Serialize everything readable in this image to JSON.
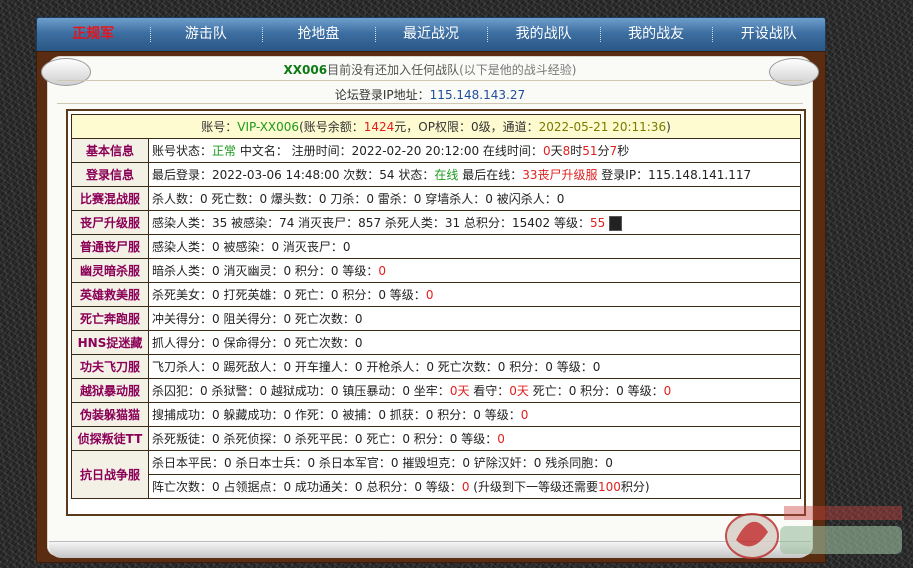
{
  "nav": {
    "items": [
      "正规军",
      "游击队",
      "抢地盘",
      "最近战况",
      "我的战队",
      "我的战友",
      "开设战队"
    ]
  },
  "header": {
    "user": "XX006",
    "status": "目前没有还加入任何战队",
    "note": "(以下是他的战斗经验)",
    "ip_label": "论坛登录IP地址：",
    "ip": "115.148.143.27"
  },
  "account": {
    "prefix": "账号：",
    "id": "VIP-XX006",
    "balance_label": "(账号余额：",
    "balance": "1424",
    "op_label": "元，OP权限：0级，通道：",
    "time": "2022-05-21 20:11:36",
    "close": ")"
  },
  "rows": [
    {
      "label": "基本信息",
      "parts": [
        [
          "账号状态："
        ],
        [
          "正常",
          "g"
        ],
        [
          " 中文名： 注册时间：2022-02-20 20:12:00 在线时间："
        ],
        [
          "0",
          "r"
        ],
        [
          "天"
        ],
        [
          "8",
          "r"
        ],
        [
          "时"
        ],
        [
          "51",
          "r"
        ],
        [
          "分"
        ],
        [
          "7",
          "r"
        ],
        [
          "秒"
        ]
      ]
    },
    {
      "label": "登录信息",
      "parts": [
        [
          "最后登录：2022-03-06 14:48:00 次数：54 状态："
        ],
        [
          "在线",
          "g"
        ],
        [
          " 最后在线："
        ],
        [
          "33丧尸升级服",
          "r"
        ],
        [
          " 登录IP：115.148.141.117"
        ]
      ]
    },
    {
      "label": "比赛混战服",
      "parts": [
        [
          "杀人数：0 死亡数：0 爆头数：0 刀杀：0 雷杀：0 穿墙杀人：0 被闪杀人：0"
        ]
      ]
    },
    {
      "label": "丧尸升级服",
      "parts": [
        [
          "感染人类：35 被感染：74 消灭丧尸：857 杀死人类：31 总积分：15402 等级："
        ],
        [
          "55",
          "r"
        ]
      ],
      "avatar": true
    },
    {
      "label": "普通丧尸服",
      "parts": [
        [
          "感染人类：0 被感染：0 消灭丧尸：0"
        ]
      ]
    },
    {
      "label": "幽灵暗杀服",
      "parts": [
        [
          "暗杀人类：0 消灭幽灵：0 积分：0 等级："
        ],
        [
          "0",
          "r"
        ]
      ]
    },
    {
      "label": "英雄救美服",
      "parts": [
        [
          "杀死美女：0 打死英雄：0 死亡：0 积分：0 等级："
        ],
        [
          "0",
          "r"
        ]
      ]
    },
    {
      "label": "死亡奔跑服",
      "parts": [
        [
          "冲关得分：0 阻关得分：0 死亡次数：0"
        ]
      ]
    },
    {
      "label": "HNS捉迷藏",
      "parts": [
        [
          "抓人得分：0 保命得分：0 死亡次数：0"
        ]
      ]
    },
    {
      "label": "功夫飞刀服",
      "parts": [
        [
          "飞刀杀人：0 踢死敌人：0 开车撞人：0 开枪杀人：0 死亡次数：0 积分：0 等级：0"
        ]
      ]
    },
    {
      "label": "越狱暴动服",
      "parts": [
        [
          "杀囚犯：0 杀狱警：0 越狱成功：0 镇压暴动：0 坐牢："
        ],
        [
          "0天",
          "r"
        ],
        [
          " 看守："
        ],
        [
          "0天",
          "r"
        ],
        [
          " 死亡：0 积分：0 等级："
        ],
        [
          "0",
          "r"
        ]
      ]
    },
    {
      "label": "伪装躲猫猫",
      "parts": [
        [
          "搜捕成功：0 躲藏成功：0 作死：0 被捕：0 抓获：0 积分：0 等级："
        ],
        [
          "0",
          "r"
        ]
      ]
    },
    {
      "label": "侦探叛徒TT",
      "parts": [
        [
          "杀死叛徒：0 杀死侦探：0 杀死平民：0 死亡：0 积分：0 等级："
        ],
        [
          "0",
          "r"
        ]
      ]
    }
  ],
  "last_row": {
    "label": "抗日战争服",
    "line1": "杀日本平民：0 杀日本士兵：0 杀日本军官：0 摧毁坦克：0 铲除汉奸：0 残杀同胞：0",
    "line2_parts": [
      [
        "阵亡次数：0 占领据点：0 成功通关：0 总积分：0 等级："
      ],
      [
        "0",
        "r"
      ],
      [
        " (升级到下一等级还需要"
      ],
      [
        "100",
        "r"
      ],
      [
        "积分)"
      ]
    ]
  }
}
